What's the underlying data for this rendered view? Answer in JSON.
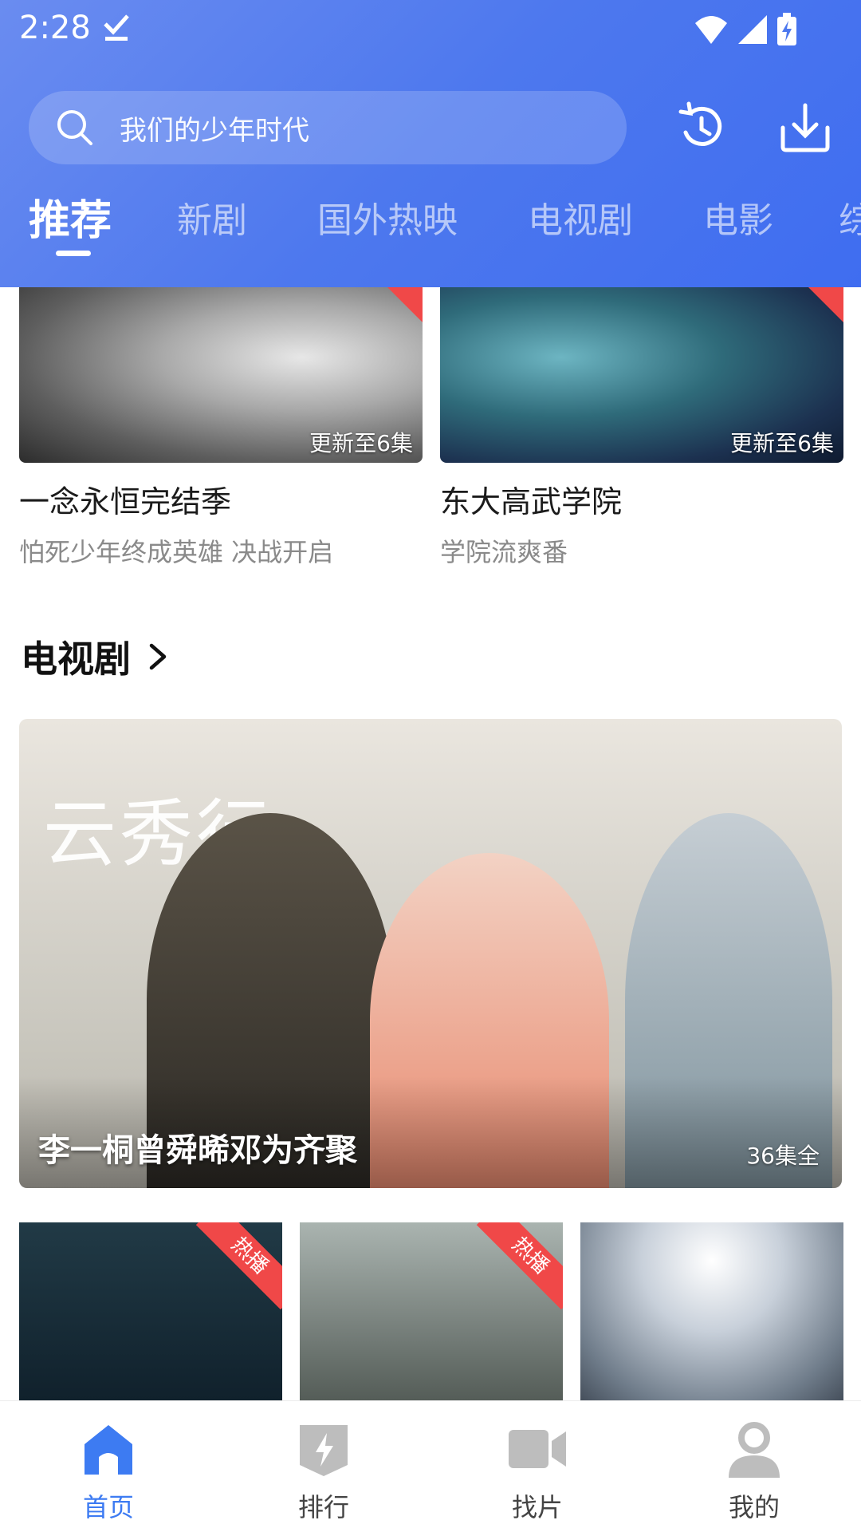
{
  "status_bar": {
    "time": "2:28"
  },
  "search": {
    "placeholder": "我们的少年时代"
  },
  "tabs": [
    {
      "label": "推荐",
      "active": true
    },
    {
      "label": "新剧"
    },
    {
      "label": "国外热映"
    },
    {
      "label": "电视剧"
    },
    {
      "label": "电影"
    },
    {
      "label": "综"
    }
  ],
  "top_cards": [
    {
      "title": "一念永恒完结季",
      "subtitle": "怕死少年终成英雄 决战开启",
      "episode": "更新至6集"
    },
    {
      "title": "东大高武学院",
      "subtitle": "学院流爽番",
      "episode": "更新至6集"
    }
  ],
  "section": {
    "title": "电视剧"
  },
  "banner": {
    "logo_text": "云秀行",
    "title": "李一桐曾舜晞邓为齐聚",
    "episode": "36集全"
  },
  "small_cards": [
    {
      "badge": "热播"
    },
    {
      "badge": "热播"
    },
    {
      "badge": ""
    }
  ],
  "bottom_nav": [
    {
      "label": "首页",
      "icon": "home-icon",
      "active": true
    },
    {
      "label": "排行",
      "icon": "rank-icon"
    },
    {
      "label": "找片",
      "icon": "video-icon"
    },
    {
      "label": "我的",
      "icon": "user-icon"
    }
  ],
  "colors": {
    "accent": "#3d7bf2",
    "hot_badge": "#f04848",
    "header_start": "#6a8cf0",
    "header_end": "#3f6df0"
  }
}
